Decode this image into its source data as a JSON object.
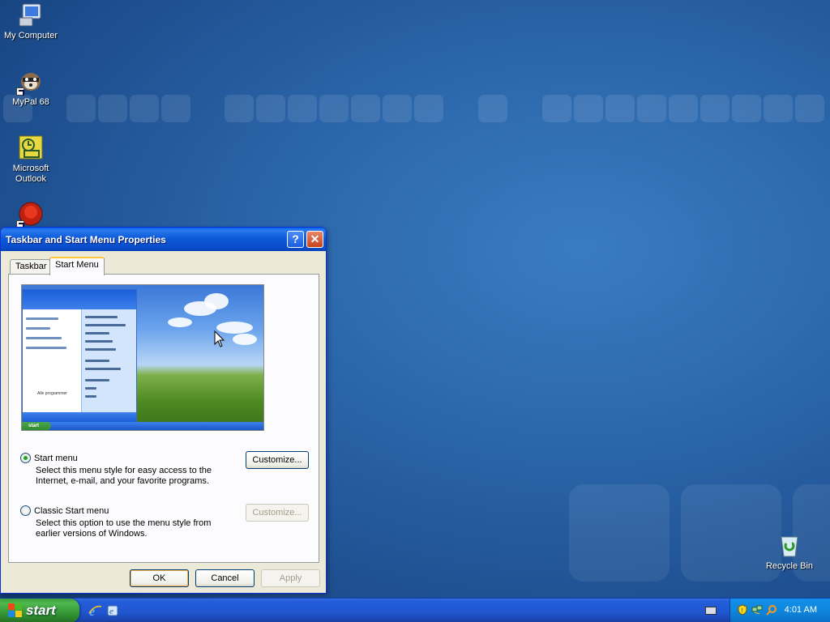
{
  "desktop": {
    "icons": [
      {
        "label": "My Computer"
      },
      {
        "label": "MyPal 68"
      },
      {
        "label": "Microsoft Outlook"
      },
      {
        "label": ""
      },
      {
        "label": "Recycle Bin"
      }
    ]
  },
  "dialog": {
    "title": "Taskbar and Start Menu Properties",
    "help_label": "?",
    "close_label": "✕",
    "tabs": [
      {
        "label": "Taskbar",
        "active": false
      },
      {
        "label": "Start Menu",
        "active": true
      }
    ],
    "preview": {
      "start_label": "start",
      "all_programs": "Alle programmer"
    },
    "options": [
      {
        "label": "Start menu",
        "checked": true,
        "description": "Select this menu style for easy access to the Internet, e-mail, and your favorite programs.",
        "customize_label": "Customize...",
        "customize_enabled": true
      },
      {
        "label": "Classic Start menu",
        "checked": false,
        "description": "Select this option to use the menu style from earlier versions of Windows.",
        "customize_label": "Customize...",
        "customize_enabled": false
      }
    ],
    "buttons": {
      "ok": "OK",
      "cancel": "Cancel",
      "apply": "Apply"
    }
  },
  "taskbar": {
    "start_label": "start",
    "clock": "4:01 AM"
  }
}
